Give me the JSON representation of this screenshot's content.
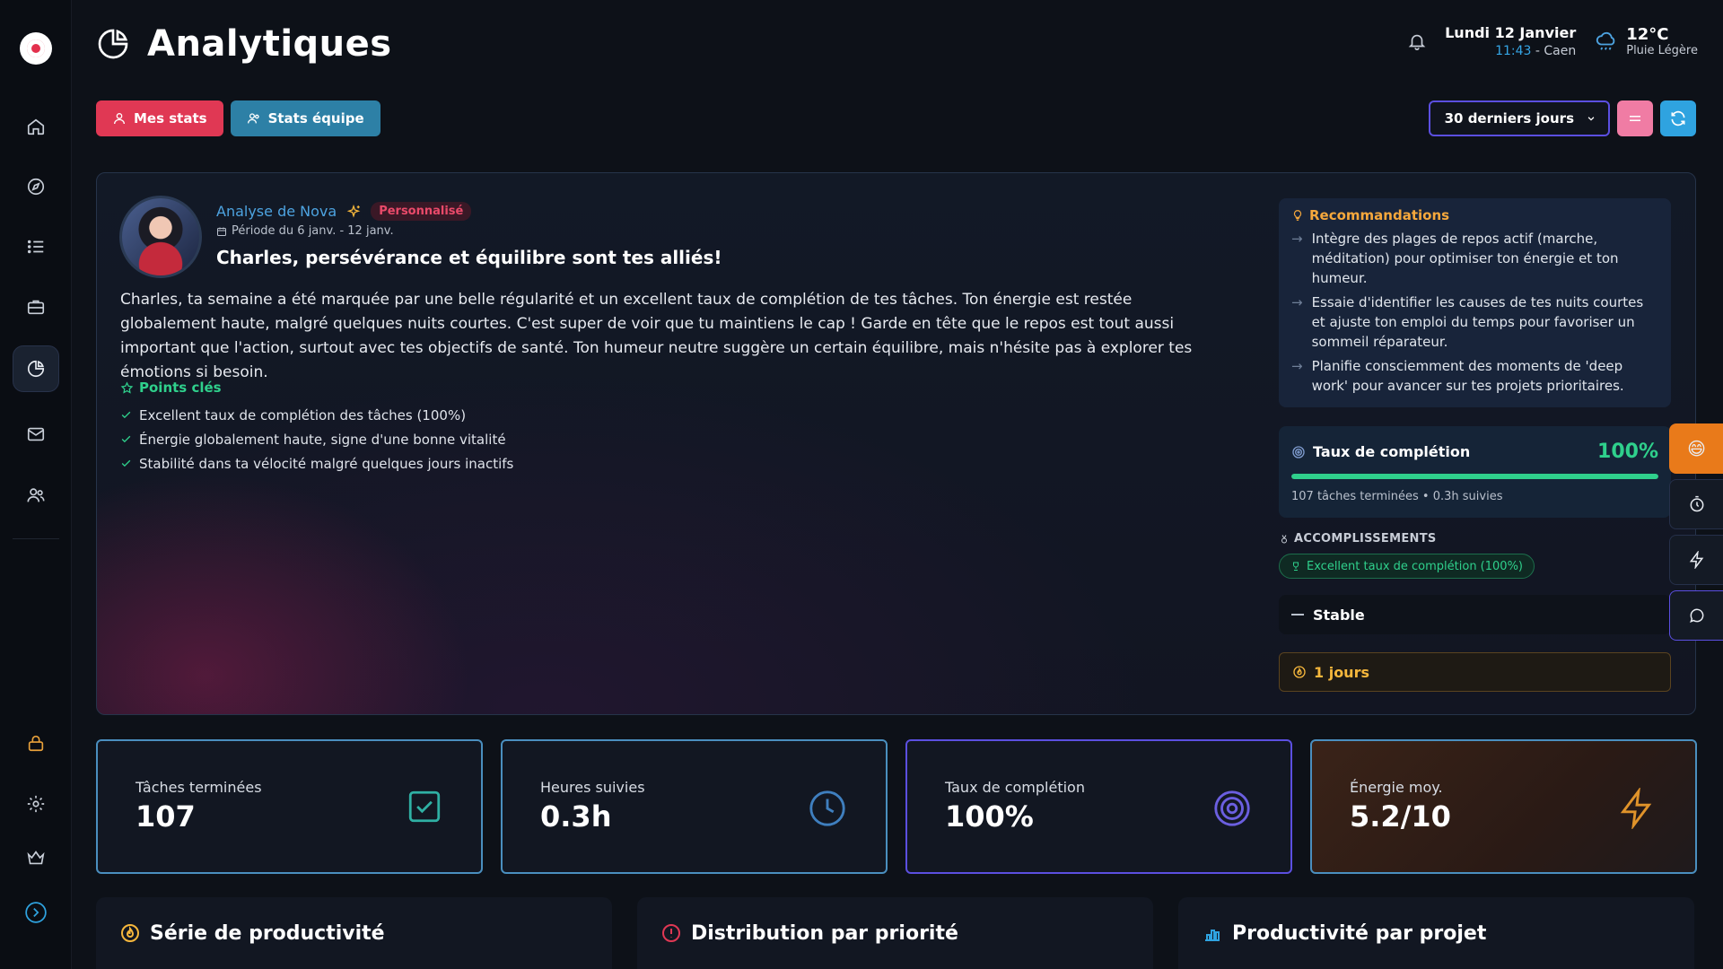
{
  "header": {
    "title": "Analytiques",
    "date": "Lundi 12 Janvier",
    "time": "11:43",
    "city": "- Caen",
    "temperature": "12°C",
    "weather": "Pluie Légère"
  },
  "toolbar": {
    "my_stats": "Mes stats",
    "team_stats": "Stats équipe",
    "period_select": "30 derniers jours"
  },
  "analysis": {
    "author": "Analyse de Nova",
    "badge": "Personnalisé",
    "period": "Période du 6 janv. - 12 janv.",
    "headline": "Charles, persévérance et équilibre sont tes alliés!",
    "summary": "Charles, ta semaine a été marquée par une belle régularité et un excellent taux de complétion de tes tâches. Ton énergie est restée globalement haute, malgré quelques nuits courtes. C'est super de voir que tu maintiens le cap ! Garde en tête que le repos est tout aussi important que l'action, surtout avec tes objectifs de santé. Ton humeur neutre suggère un certain équilibre, mais n'hésite pas à explorer tes émotions si besoin.",
    "key_points_title": "Points clés",
    "key_points": [
      "Excellent taux de complétion des tâches (100%)",
      "Énergie globalement haute, signe d'une bonne vitalité",
      "Stabilité dans ta vélocité malgré quelques jours inactifs"
    ]
  },
  "recommendations": {
    "title": "Recommandations",
    "items": [
      "Intègre des plages de repos actif (marche, méditation) pour optimiser ton énergie et ton humeur.",
      "Essaie d'identifier les causes de tes nuits courtes et ajuste ton emploi du temps pour favoriser un sommeil réparateur.",
      "Planifie consciemment des moments de 'deep work' pour avancer sur tes projets prioritaires."
    ]
  },
  "completion": {
    "title": "Taux de complétion",
    "value": "100%",
    "fraction": 1.0,
    "subtitle": "107 tâches terminées • 0.3h suivies"
  },
  "achievements": {
    "title": "ACCOMPLISSEMENTS",
    "badge": "Excellent taux de complétion (100%)"
  },
  "trend": "Stable",
  "streak": "1 jours",
  "stats": [
    {
      "label": "Tâches terminées",
      "value": "107",
      "icon": "check-square-icon",
      "color": "#2fb0a4"
    },
    {
      "label": "Heures suivies",
      "value": "0.3h",
      "icon": "clock-icon",
      "color": "#3f7fbf"
    },
    {
      "label": "Taux de complétion",
      "value": "100%",
      "icon": "target-icon",
      "color": "#6b5fe0"
    },
    {
      "label": "Énergie moy.",
      "value": "5.2/10",
      "icon": "lightning-icon",
      "color": "#e0932a"
    }
  ],
  "panels": [
    {
      "title": "Série de productivité",
      "icon": "flame-icon"
    },
    {
      "title": "Distribution par priorité",
      "icon": "alert-circle-icon"
    },
    {
      "title": "Productivité par projet",
      "icon": "bar-chart-icon"
    }
  ],
  "colors": {
    "accent_red": "#e03854",
    "accent_teal": "#2d80a6",
    "success": "#2fd08c",
    "warning": "#f6b73c",
    "link_blue": "#4da3e0"
  },
  "floating_actions": {
    "emoji": "😄"
  }
}
